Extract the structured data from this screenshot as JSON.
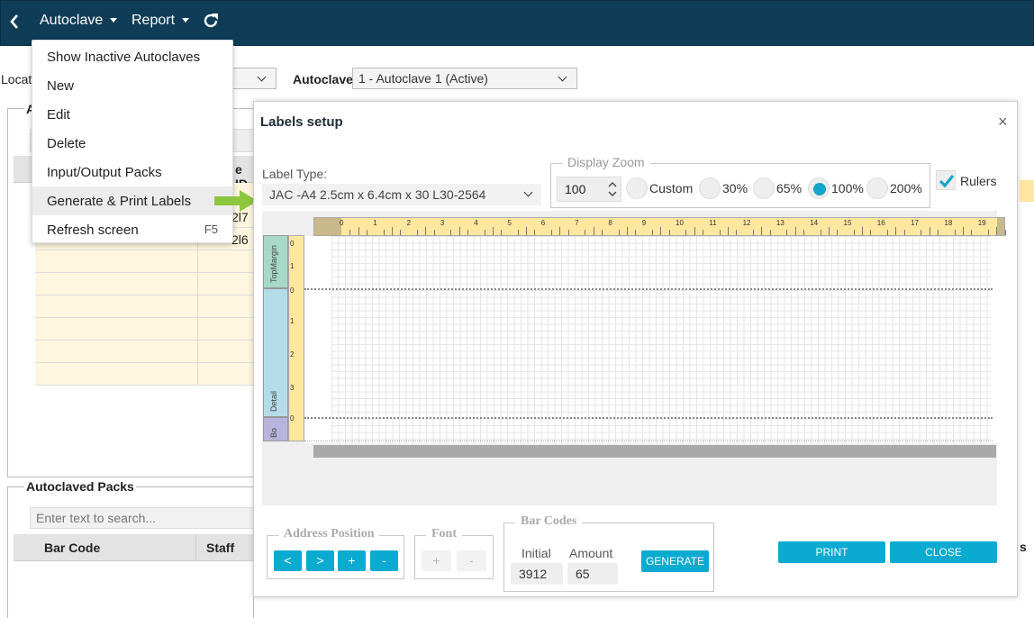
{
  "nav": {
    "back_icon": "chevron-left-icon",
    "autoclave": "Autoclave",
    "report": "Report",
    "refresh_icon": "refresh-icon"
  },
  "menu": {
    "items": [
      {
        "label": "Show Inactive Autoclaves",
        "shortcut": ""
      },
      {
        "label": "New",
        "shortcut": ""
      },
      {
        "label": "Edit",
        "shortcut": ""
      },
      {
        "label": "Delete",
        "shortcut": ""
      },
      {
        "label": "Input/Output Packs",
        "shortcut": ""
      },
      {
        "label": "Generate & Print Labels",
        "shortcut": ""
      },
      {
        "label": "Refresh screen",
        "shortcut": "F5"
      }
    ],
    "highlighted_index": 5
  },
  "background": {
    "location_label": "Locat",
    "autoclave_label": "Autoclave",
    "autoclave_value": "1 - Autoclave 1 (Active)",
    "panel_title_partial": "A",
    "col_partial": "e ID",
    "cell_1": "2l7",
    "cell_2": "2l6",
    "packs_title": "Autoclaved Packs",
    "search_placeholder": "Enter text to search...",
    "col_bar_code": "Bar Code",
    "col_staff": "Staff",
    "col_right_partial": "s"
  },
  "dialog": {
    "title": "Labels setup",
    "close_glyph": "×",
    "label_type_label": "Label Type:",
    "label_type_value": "JAC  -A4 2.5cm x 6.4cm x 30 L30-2564",
    "zoom_legend": "Display Zoom",
    "zoom_value": "100",
    "zoom_options": [
      "Custom",
      "30%",
      "65%",
      "100%",
      "200%"
    ],
    "zoom_selected": "100%",
    "rulers_label": "Rulers",
    "rulers_checked": true,
    "ruler_numbers": [
      "0",
      "1",
      "2",
      "3",
      "4",
      "5",
      "6",
      "7",
      "8",
      "9",
      "10",
      "11",
      "12",
      "13",
      "14",
      "15",
      "16",
      "17",
      "18",
      "19"
    ],
    "band_top": "TopMargin",
    "band_detail": "Detail",
    "band_bottom": "Bo",
    "vruler_top": [
      "0",
      "1"
    ],
    "vruler_detail": [
      "0",
      "1",
      "2",
      "3"
    ],
    "vruler_bottom": [
      "0"
    ],
    "address_legend": "Address Position",
    "address_buttons": [
      "<",
      ">",
      "+",
      "-"
    ],
    "font_legend": "Font",
    "font_buttons": [
      "+",
      "-"
    ],
    "barcodes_legend": "Bar Codes",
    "initial_label": "Initial",
    "amount_label": "Amount",
    "initial_value": "3912",
    "amount_value": "65",
    "generate": "GENERATE",
    "print": "PRINT",
    "close": "CLOSE"
  },
  "colors": {
    "topbar": "#0f3d57",
    "accent": "#0aaad1",
    "ruler": "#ffe7a0",
    "band_top": "#a8d8c8",
    "band_detail": "#b5dde9",
    "band_bottom": "#b8b4dc",
    "arrow": "#8dc63f"
  }
}
